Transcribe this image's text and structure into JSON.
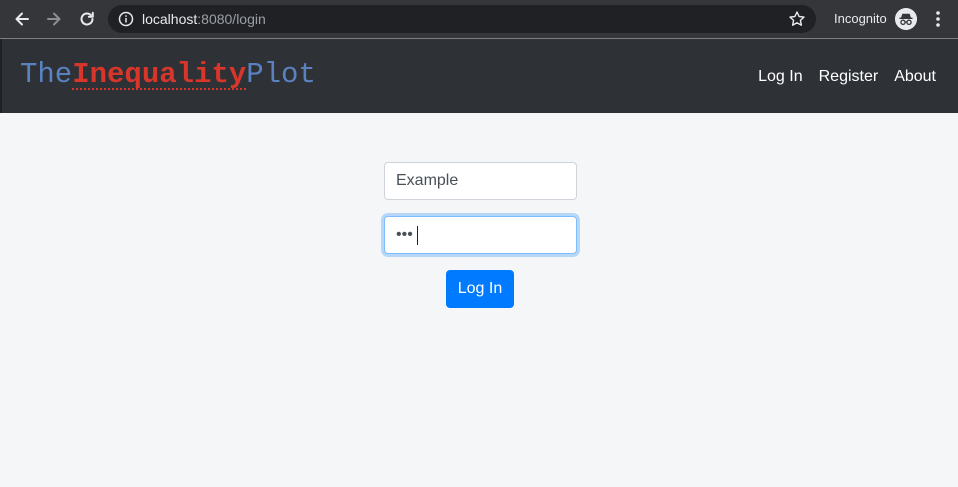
{
  "browser": {
    "url_host": "localhost",
    "url_rest": ":8080/login",
    "incognito_label": "Incognito"
  },
  "navbar": {
    "brand": {
      "part1": "The",
      "part2": "Inequality",
      "part3": "Plot"
    },
    "links": [
      "Log In",
      "Register",
      "About"
    ]
  },
  "form": {
    "username_value": "Example",
    "password_value": "•••",
    "submit_label": "Log In"
  },
  "colors": {
    "accent": "#007bff",
    "brand_blue": "#5a82c0",
    "brand_red": "#d9362b",
    "navbar_bg": "#2e3237",
    "page_bg": "#f5f6f8"
  }
}
